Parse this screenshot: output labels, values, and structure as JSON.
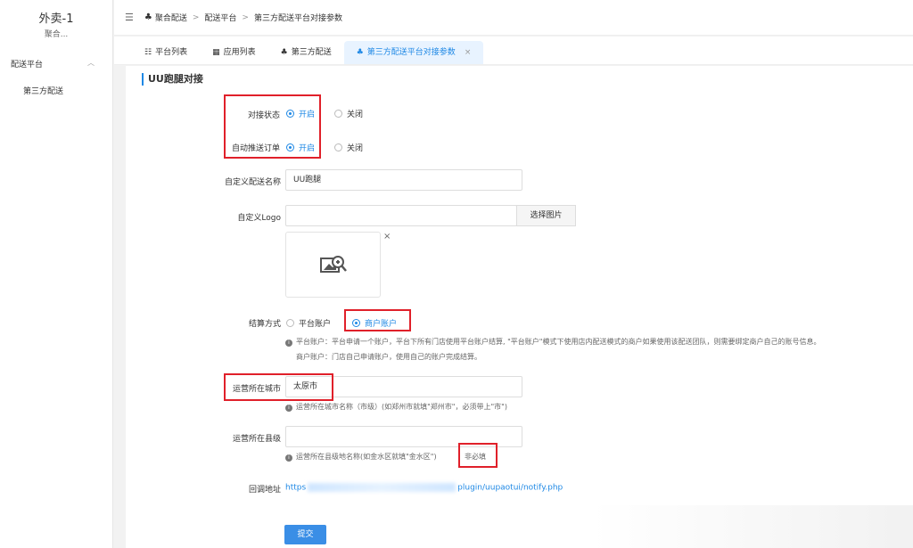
{
  "sidebar": {
    "brand_title": "外卖-1",
    "brand_sub": "聚合...",
    "group_label": "配送平台",
    "items": [
      {
        "label": "第三方配送"
      }
    ]
  },
  "breadcrumb": {
    "items": [
      "聚合配送",
      "配送平台",
      "第三方配送平台对接参数"
    ]
  },
  "tabs": [
    {
      "label": "平台列表"
    },
    {
      "label": "应用列表"
    },
    {
      "label": "第三方配送"
    },
    {
      "label": "第三方配送平台对接参数",
      "close": "×"
    }
  ],
  "panel": {
    "title": "UU跑腿对接",
    "status": {
      "label": "对接状态",
      "options": [
        "开启",
        "关闭"
      ],
      "selected": "开启"
    },
    "auto_push": {
      "label": "自动推送订单",
      "options": [
        "开启",
        "关闭"
      ],
      "selected": "开启"
    },
    "custom_name": {
      "label": "自定义配送名称",
      "value": "UU跑腿"
    },
    "custom_logo": {
      "label": "自定义Logo",
      "value": "",
      "button": "选择图片",
      "remove": "×"
    },
    "settlement": {
      "label": "结算方式",
      "options": [
        "平台账户",
        "商户账户"
      ],
      "selected": "商户账户",
      "hint_1": "平台账户：平台申请一个账户，平台下所有门店使用平台账户结算, \"平台账户\"模式下使用店内配送模式的商户如果使用该配送团队，则需要绑定商户自己的账号信息。",
      "hint_2": "商户账户：门店自己申请账户，使用自己的账户完成结算。"
    },
    "city": {
      "label": "运营所在城市",
      "value": "太原市",
      "hint": "运营所在城市名称（市级）(如郑州市就填\"郑州市\"，必须带上\"市\")"
    },
    "county": {
      "label": "运营所在县级",
      "value": "",
      "hint": "运营所在县级地名称(如金水区就填\"金水区\")",
      "hint_tag": "非必填"
    },
    "callback": {
      "label": "回调地址",
      "prefix": "https",
      "suffix": "plugin/uupaotui/notify.php"
    }
  },
  "submit_label": "提交",
  "colors": {
    "accent": "#1e88e5",
    "highlight": "#e0202a"
  }
}
